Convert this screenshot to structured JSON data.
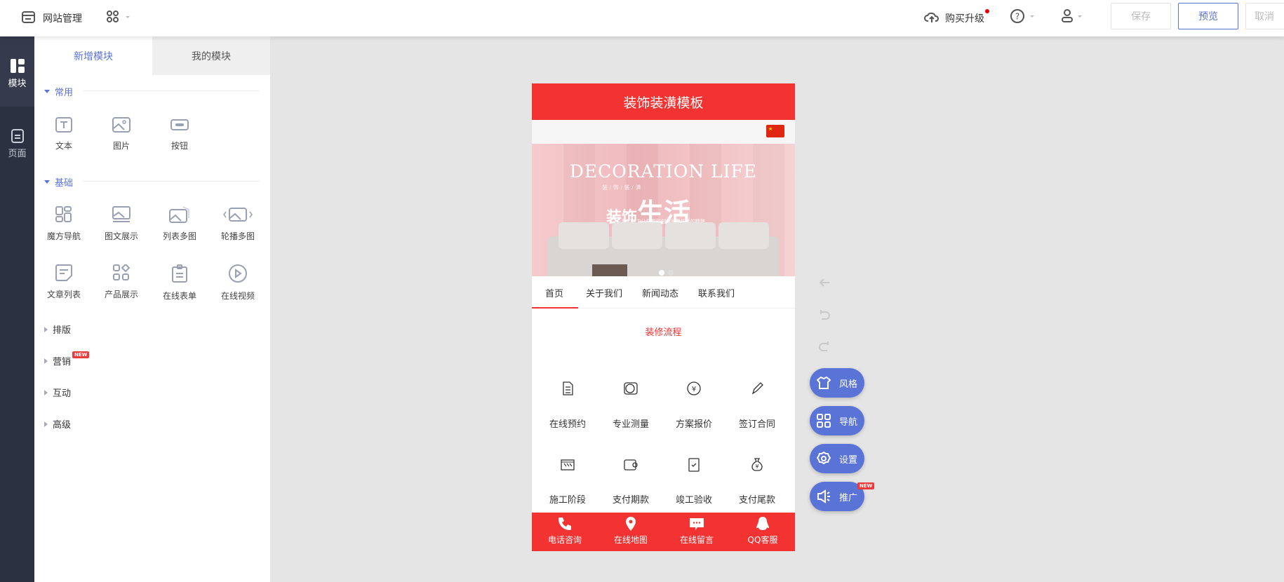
{
  "topbar": {
    "site_manage": "网站管理",
    "upgrade": "购买升级",
    "save": "保存",
    "preview": "预览",
    "cancel": "取消"
  },
  "rail": [
    {
      "label": "模块",
      "icon": "module-icon"
    },
    {
      "label": "页面",
      "icon": "page-icon"
    }
  ],
  "panel": {
    "tabs": [
      "新增模块",
      "我的模块"
    ],
    "common": {
      "title": "常用",
      "items": [
        "文本",
        "图片",
        "按钮"
      ]
    },
    "basic": {
      "title": "基础",
      "items": [
        "魔方导航",
        "图文展示",
        "列表多图",
        "轮播多图",
        "文章列表",
        "产品展示",
        "在线表单",
        "在线视频"
      ]
    },
    "collapsed": [
      "排版",
      "营销",
      "互动",
      "高级"
    ],
    "new_badge": "NEW"
  },
  "phone": {
    "title": "装饰装潢模板",
    "banner": {
      "en": "DECORATION LIFE",
      "small": "装 / 饰 / 装 / 潢",
      "big1": "装饰",
      "big2": "生活",
      "sub": "我们努力让您能时刻体验着生活的精致"
    },
    "nav": [
      "首页",
      "关于我们",
      "新闻动态",
      "联系我们"
    ],
    "section_title": "装修流程",
    "steps": [
      "在线预约",
      "专业测量",
      "方案报价",
      "签订合同",
      "施工阶段",
      "支付期款",
      "竣工验收",
      "支付尾款"
    ],
    "footer": [
      "电话咨询",
      "在线地图",
      "在线留言",
      "QQ客服"
    ],
    "accent": "#f33232"
  },
  "tools": {
    "pills": [
      "风格",
      "导航",
      "设置",
      "推广"
    ],
    "new_badge": "NEW"
  },
  "colors": {
    "primary": "#5a73d6",
    "rail": "#2c3142"
  }
}
